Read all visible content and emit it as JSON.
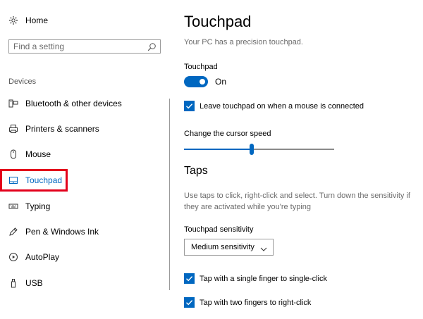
{
  "sidebar": {
    "home_label": "Home",
    "search_placeholder": "Find a setting",
    "section_label": "Devices",
    "items": [
      {
        "label": "Bluetooth & other devices",
        "icon": "bluetooth-icon"
      },
      {
        "label": "Printers & scanners",
        "icon": "printer-icon"
      },
      {
        "label": "Mouse",
        "icon": "mouse-icon"
      },
      {
        "label": "Touchpad",
        "icon": "touchpad-icon",
        "active": true
      },
      {
        "label": "Typing",
        "icon": "keyboard-icon"
      },
      {
        "label": "Pen & Windows Ink",
        "icon": "pen-icon"
      },
      {
        "label": "AutoPlay",
        "icon": "autoplay-icon"
      },
      {
        "label": "USB",
        "icon": "usb-icon"
      }
    ]
  },
  "main": {
    "title": "Touchpad",
    "subtitle": "Your PC has a precision touchpad.",
    "touchpad_toggle": {
      "label": "Touchpad",
      "state": "On",
      "on": true
    },
    "leave_on_checkbox": {
      "label": "Leave touchpad on when a mouse is connected",
      "checked": true
    },
    "cursor_speed": {
      "label": "Change the cursor speed",
      "value_fraction": 0.45
    },
    "taps": {
      "heading": "Taps",
      "description": "Use taps to click, right-click and select. Turn down the sensitivity if they are activated while you're typing",
      "sensitivity_label": "Touchpad sensitivity",
      "sensitivity_value": "Medium sensitivity",
      "single_finger_checkbox": {
        "label": "Tap with a single finger to single-click",
        "checked": true
      },
      "two_finger_checkbox": {
        "label": "Tap with two fingers to right-click",
        "checked": true
      }
    }
  },
  "colors": {
    "accent": "#0067c0",
    "highlight": "#e3001b"
  }
}
